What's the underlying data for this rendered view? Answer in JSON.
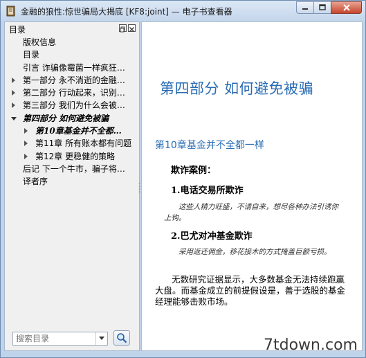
{
  "window": {
    "title": "金融的狼性:惊世骗局大揭底 [KF8:joint] — 电子书查看器"
  },
  "toc": {
    "title": "目录",
    "items": [
      {
        "label": "版权信息",
        "level": 0,
        "arrow": "none",
        "style": "normal"
      },
      {
        "label": "目录",
        "level": 0,
        "arrow": "none",
        "style": "normal"
      },
      {
        "label": "引言  诈骗像霉菌一样疯狂…",
        "level": 0,
        "arrow": "none",
        "style": "normal"
      },
      {
        "label": "第一部分  永不消逝的金融…",
        "level": 0,
        "arrow": "right",
        "style": "normal"
      },
      {
        "label": "第二部分  行动起来，识别…",
        "level": 0,
        "arrow": "right",
        "style": "normal"
      },
      {
        "label": "第三部分  我们为什么会被…",
        "level": 0,
        "arrow": "right",
        "style": "normal"
      },
      {
        "label": "第四部分  如何避免被骗",
        "level": 0,
        "arrow": "down",
        "style": "bold-italic"
      },
      {
        "label": "第10章基金并不全都…",
        "level": 1,
        "arrow": "right",
        "style": "bold-italic"
      },
      {
        "label": "第11章  所有账本都有问题",
        "level": 1,
        "arrow": "right",
        "style": "normal"
      },
      {
        "label": "第12章  更稳健的策略",
        "level": 1,
        "arrow": "right",
        "style": "normal"
      },
      {
        "label": "后记  下一个牛市，骗子将…",
        "level": 0,
        "arrow": "none",
        "style": "normal"
      },
      {
        "label": "译者序",
        "level": 0,
        "arrow": "none",
        "style": "normal"
      }
    ],
    "search_placeholder": "搜索目录"
  },
  "content": {
    "part_title": "第四部分    如何避免被骗",
    "chapter_title": "第10章基金并不全都一样",
    "fraud_heading": "欺诈案例：",
    "case1_heading": "1.电话交易所欺诈",
    "case1_text": "这些人精力旺盛，不请自来，想尽各种办法引诱你上钩。",
    "case2_heading": "2.巴尤对冲基金欺诈",
    "case2_text": "采用返还佣金，移花接木的方式掩盖巨额亏损。",
    "body_text": "无数研究证据显示，大多数基金无法持续跑赢大盘。而基金成立的前提假设是，善于选股的基金经理能够击败市场。"
  },
  "watermark": "7tdown.com",
  "colors": {
    "accent": "#2a6db4",
    "close_button": "#c7452c"
  }
}
